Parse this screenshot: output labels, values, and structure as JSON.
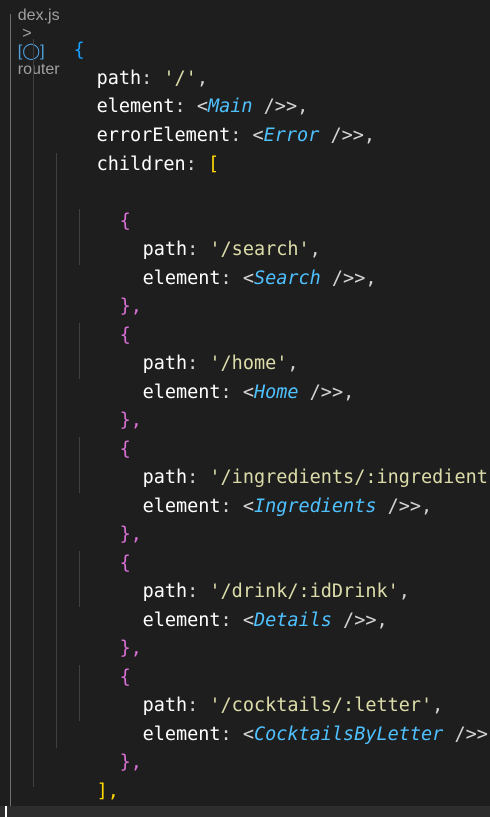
{
  "breadcrumb": {
    "file": "dex.js",
    "separator": ">",
    "icon": "[◯]",
    "symbol": "router"
  },
  "code": {
    "open_brace": "{",
    "path_key": "path",
    "colon": ":",
    "comma": ",",
    "root_path": "'/'",
    "element_key": "element",
    "error_element_key": "errorElement",
    "children_key": "children",
    "open_bracket": "[",
    "close_bracket": "],",
    "close_brace_outer": "},",
    "jsx_open": "<",
    "jsx_close": " />",
    "main_component": "Main",
    "error_component": "Error",
    "routes": [
      {
        "path": "'/search'",
        "component": "Search"
      },
      {
        "path": "'/home'",
        "component": "Home"
      },
      {
        "path": "'/ingredients/:ingredient'",
        "component": "Ingredients"
      },
      {
        "path": "'/drink/:idDrink'",
        "component": "Details"
      },
      {
        "path": "'/cocktails/:letter'",
        "component": "CocktailsByLetter"
      }
    ],
    "route_open": "{",
    "route_close": "},"
  }
}
